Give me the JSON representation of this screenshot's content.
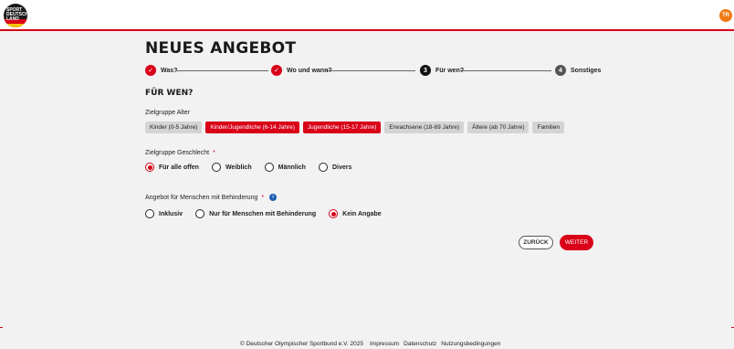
{
  "header": {
    "logo_text": "SPORT DEUTSCH LAND",
    "user_initials": "TR"
  },
  "page": {
    "title": "NEUES ANGEBOT",
    "section_title": "FÜR WEN?"
  },
  "stepper": [
    {
      "label": "Was?",
      "state": "done",
      "marker": "✓"
    },
    {
      "label": "Wo und wann?",
      "state": "done",
      "marker": "✓"
    },
    {
      "label": "Für wen?",
      "state": "current",
      "marker": "3"
    },
    {
      "label": "Sonstiges",
      "state": "todo",
      "marker": "4"
    }
  ],
  "age_group": {
    "label": "Zielgruppe Alter",
    "chips": [
      {
        "label": "Kinder (0-5 Jahre)",
        "selected": false
      },
      {
        "label": "Kinder/Jugendliche (6-14 Jahre)",
        "selected": true
      },
      {
        "label": "Jugendliche (15-17 Jahre)",
        "selected": true
      },
      {
        "label": "Erwachsene (18-69 Jahre)",
        "selected": false
      },
      {
        "label": "Ältere (ab 70 Jahre)",
        "selected": false
      },
      {
        "label": "Familien",
        "selected": false
      }
    ]
  },
  "gender": {
    "label": "Zielgruppe Geschlecht",
    "required_marker": "*",
    "options": [
      {
        "label": "Für alle offen",
        "checked": true
      },
      {
        "label": "Weiblich",
        "checked": false
      },
      {
        "label": "Männlich",
        "checked": false
      },
      {
        "label": "Divers",
        "checked": false
      }
    ]
  },
  "disability": {
    "label": "Angebot für Menschen mit Behinderung",
    "required_marker": "*",
    "info_icon": "i",
    "options": [
      {
        "label": "Inklusiv",
        "checked": false
      },
      {
        "label": "Nur für Menschen mit Behinderung",
        "checked": false
      },
      {
        "label": "Kein Angabe",
        "checked": true
      }
    ]
  },
  "actions": {
    "back_label": "ZURÜCK",
    "next_label": "WEITER"
  },
  "footer": {
    "copyright": "© Deutscher Olympischer Sportbund e.V. 2025",
    "links": [
      "Impressum",
      "Datenschutz",
      "Nutzungsbedingungen"
    ]
  },
  "colors": {
    "accent": "#d90018",
    "chip_inactive": "#d4d4d4",
    "avatar": "#f07a12",
    "info": "#1d5fb4"
  }
}
